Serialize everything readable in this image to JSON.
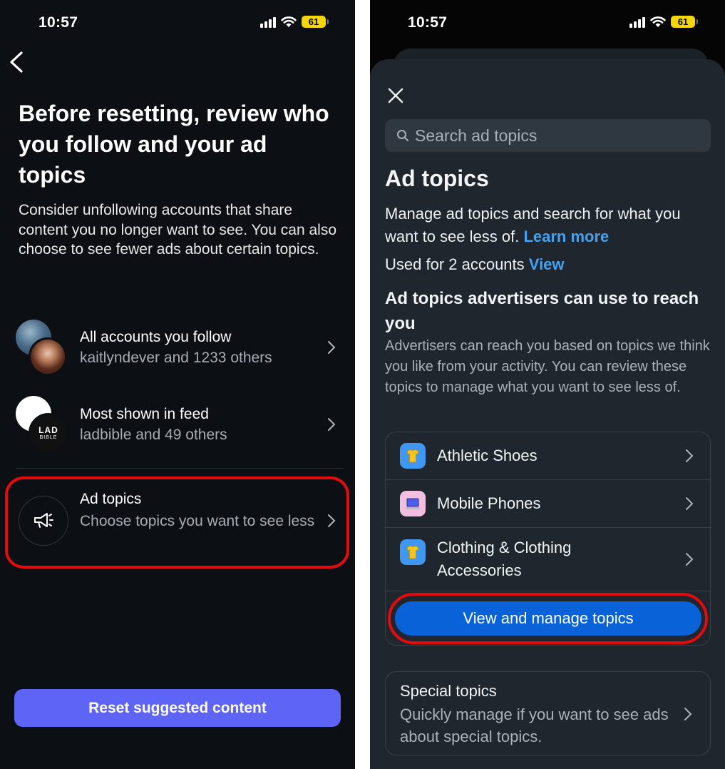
{
  "left": {
    "status": {
      "time": "10:57",
      "battery": "61"
    },
    "title": "Before resetting, review who you follow and your ad topics",
    "description": "Consider unfollowing accounts that share content you no longer want to see. You can also choose to see fewer ads about certain topics.",
    "rows": [
      {
        "title": "All accounts you follow",
        "subtitle": "kaitlyndever and 1233 others"
      },
      {
        "title": "Most shown in feed",
        "subtitle": "ladbible and 49 others"
      },
      {
        "title": "Ad topics",
        "subtitle": "Choose topics you want to see less"
      }
    ],
    "avatar_text": {
      "lad_line1": "LAD",
      "lad_line2": "BIBLE"
    },
    "reset_button": "Reset suggested content",
    "highlight_color": "#e30b0b"
  },
  "right": {
    "status": {
      "time": "10:57",
      "battery": "61"
    },
    "search_placeholder": "Search ad topics",
    "title": "Ad topics",
    "description": "Manage ad topics and search for what you want to see less of.",
    "learn_more": "Learn more",
    "used_for": "Used for 2 accounts",
    "view_link": "View",
    "heading": "Ad topics advertisers can use to reach you",
    "paragraph": "Advertisers can reach you based on topics we think you like from your activity. You can review these topics to manage what you want to see less of.",
    "topics": [
      {
        "label": "Athletic Shoes",
        "icon": "shirt-icon"
      },
      {
        "label": "Mobile Phones",
        "icon": "laptop-icon"
      },
      {
        "label": "Clothing & Clothing Accessories",
        "icon": "shirt-icon"
      }
    ],
    "manage_button": "View and manage topics",
    "special": {
      "title": "Special topics",
      "description": "Quickly manage if you want to see ads about special topics."
    },
    "accent_color": "#46a2f0",
    "button_color": "#0a62d8"
  }
}
